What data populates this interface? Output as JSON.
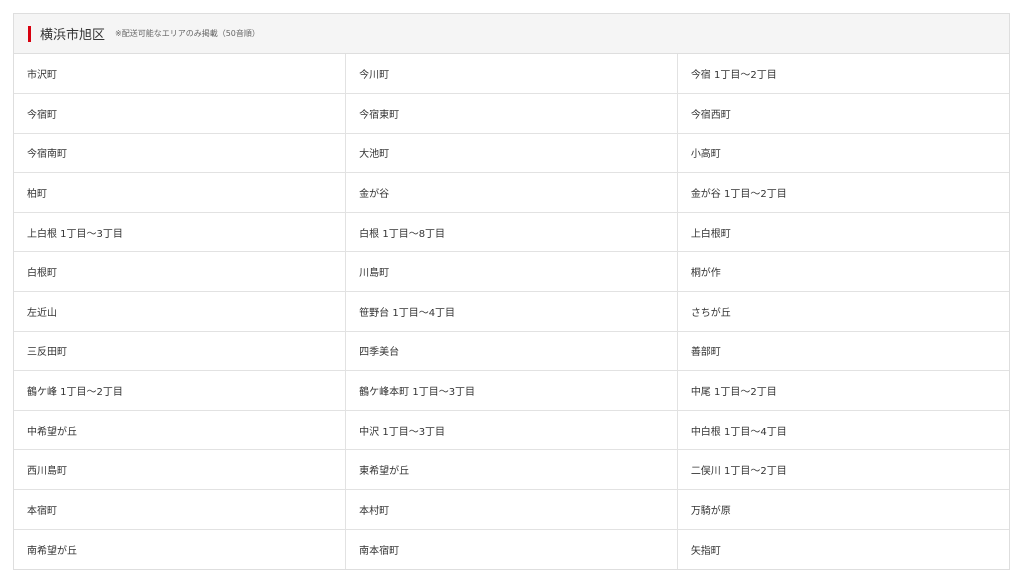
{
  "header": {
    "title": "横浜市旭区",
    "note": "※配送可能なエリアのみ掲載（50音順）",
    "accent_color": "#d7000f"
  },
  "rows": [
    [
      "市沢町",
      "今川町",
      "今宿 1丁目～2丁目"
    ],
    [
      "今宿町",
      "今宿東町",
      "今宿西町"
    ],
    [
      "今宿南町",
      "大池町",
      "小高町"
    ],
    [
      "柏町",
      "金が谷",
      "金が谷 1丁目～2丁目"
    ],
    [
      "上白根 1丁目～3丁目",
      "白根 1丁目～8丁目",
      "上白根町"
    ],
    [
      "白根町",
      "川島町",
      "桐が作"
    ],
    [
      "左近山",
      "笹野台 1丁目～4丁目",
      "さちが丘"
    ],
    [
      "三反田町",
      "四季美台",
      "善部町"
    ],
    [
      "鶴ケ峰 1丁目～2丁目",
      "鶴ケ峰本町 1丁目～3丁目",
      "中尾 1丁目～2丁目"
    ],
    [
      "中希望が丘",
      "中沢 1丁目～3丁目",
      "中白根 1丁目～4丁目"
    ],
    [
      "西川島町",
      "東希望が丘",
      "二俣川 1丁目～2丁目"
    ],
    [
      "本宿町",
      "本村町",
      "万騎が原"
    ],
    [
      "南希望が丘",
      "南本宿町",
      "矢指町"
    ]
  ]
}
